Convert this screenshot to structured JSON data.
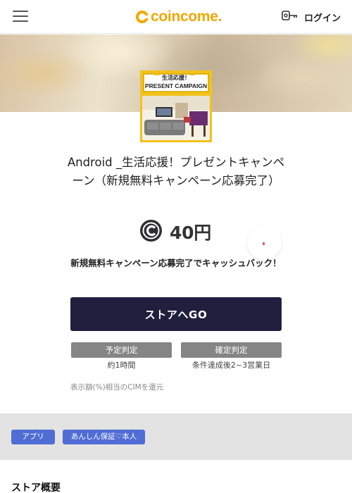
{
  "header": {
    "logo_text": "coincome.",
    "login_label": "ログイン",
    "icons": {
      "menu": "hamburger-menu-icon",
      "login": "key-icon",
      "logo": "coin-logo-icon"
    },
    "brand_color": "#f0a800"
  },
  "campaign": {
    "thumbnail": {
      "line1": "生活応援！",
      "line2": "PRESENT CAMPAIGN"
    },
    "title": "Android _生活応援！プレゼントキャンペーン（新規無料キャンペーン応募完了）",
    "reward": {
      "amount": "40円",
      "icon": "coin-icon"
    },
    "favorite_icon": "heart-icon",
    "condition": "新規無料キャンペーン応募完了でキャッシュバック！",
    "cta_label": "ストアへGO",
    "cta_color": "#20203e",
    "judgements": [
      {
        "label": "予定判定",
        "desc": "約1時間"
      },
      {
        "label": "確定判定",
        "desc": "条件達成後2~3営業日"
      }
    ],
    "note": "表示額(%)相当のCIMを還元"
  },
  "tags": [
    "アプリ",
    "あんしん保証♡本人"
  ],
  "tag_color": "#4f6dd4",
  "store_section": {
    "title": "ストア概要"
  }
}
